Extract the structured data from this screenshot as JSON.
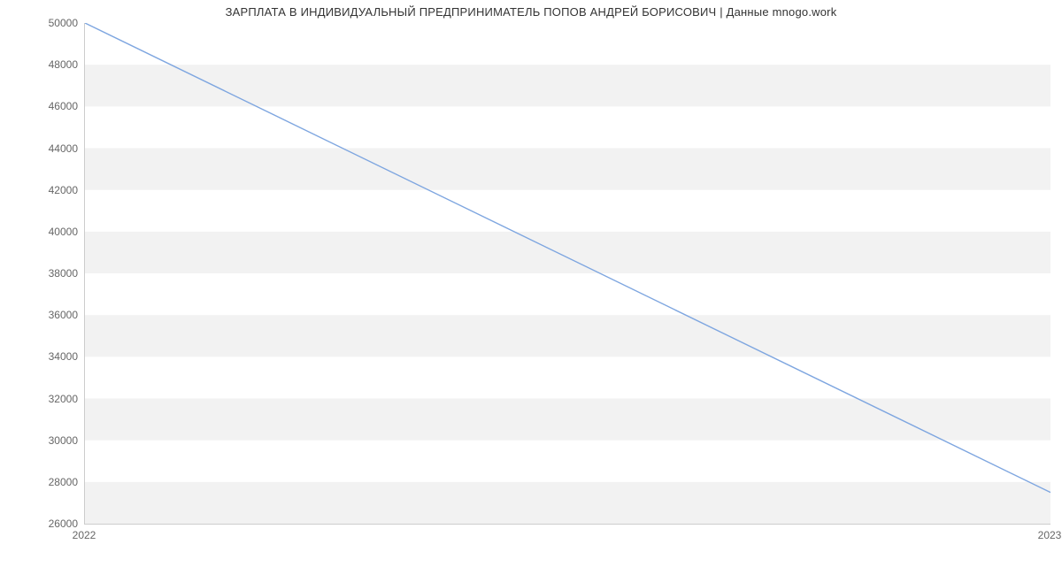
{
  "chart_data": {
    "type": "line",
    "title": "ЗАРПЛАТА В ИНДИВИДУАЛЬНЫЙ ПРЕДПРИНИМАТЕЛЬ ПОПОВ АНДРЕЙ БОРИСОВИЧ | Данные mnogo.work",
    "xlabel": "",
    "ylabel": "",
    "x": [
      2022,
      2023
    ],
    "values": [
      50000,
      27500
    ],
    "ylim": [
      26000,
      50000
    ],
    "y_ticks": [
      26000,
      28000,
      30000,
      32000,
      34000,
      36000,
      38000,
      40000,
      42000,
      44000,
      46000,
      48000,
      50000
    ],
    "x_ticks": [
      2022,
      2023
    ],
    "line_color": "#7ea6e0",
    "band_color": "#f2f2f2"
  }
}
